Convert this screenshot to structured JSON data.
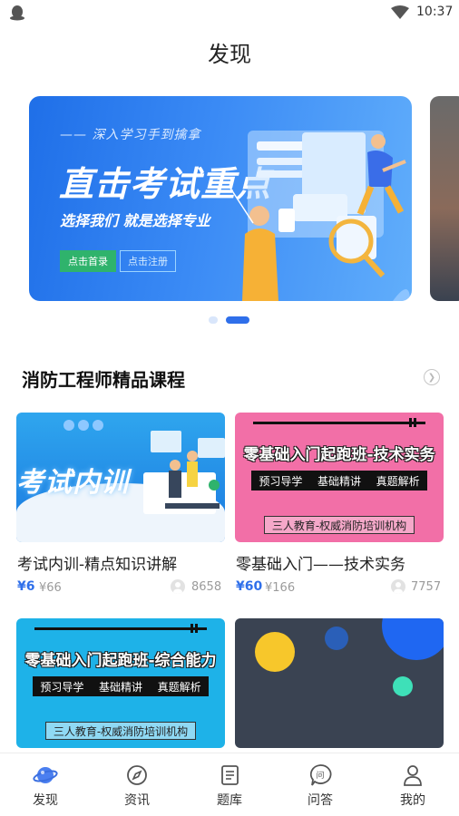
{
  "status_bar": {
    "time": "10:37"
  },
  "page": {
    "title": "发现"
  },
  "banner": {
    "kicker": "—— 深入学习手到擒拿",
    "headline": "直击考试重点",
    "subline": "选择我们 就是选择专业",
    "home_button": "点击首录",
    "register_button": "点击注册",
    "slide_count": 2,
    "active_slide": 2
  },
  "section": {
    "title": "消防工程师精品课程"
  },
  "courses": [
    {
      "name": "考试内训-精点知识讲解",
      "price": "¥6",
      "original_price": "¥66",
      "learners": "8658",
      "thumb": {
        "style": "illustration",
        "label": "考试内训"
      }
    },
    {
      "name": "零基础入门——技术实务",
      "price": "¥60",
      "original_price": "¥166",
      "learners": "7757",
      "thumb": {
        "style": "pink",
        "title": "零基础入门起跑班-技术实务",
        "tags": [
          "预习导学",
          "基础精讲",
          "真题解析"
        ],
        "org": "三人教育-权威消防培训机构"
      }
    },
    {
      "thumb": {
        "style": "cyan",
        "title": "零基础入门起跑班-综合能力",
        "tags": [
          "预习导学",
          "基础精讲",
          "真题解析"
        ],
        "org": "三人教育-权威消防培训机构"
      }
    },
    {
      "thumb": {
        "style": "dark"
      }
    }
  ],
  "tabs": [
    {
      "label": "发现",
      "icon": "planet-icon",
      "active": true
    },
    {
      "label": "资讯",
      "icon": "compass-icon",
      "active": false
    },
    {
      "label": "题库",
      "icon": "document-icon",
      "active": false
    },
    {
      "label": "问答",
      "icon": "question-bubble-icon",
      "active": false
    },
    {
      "label": "我的",
      "icon": "user-icon",
      "active": false
    }
  ],
  "colors": {
    "accent": "#2f6fea",
    "price": "#2f6fea",
    "tab_active": "#3b6fe0"
  }
}
